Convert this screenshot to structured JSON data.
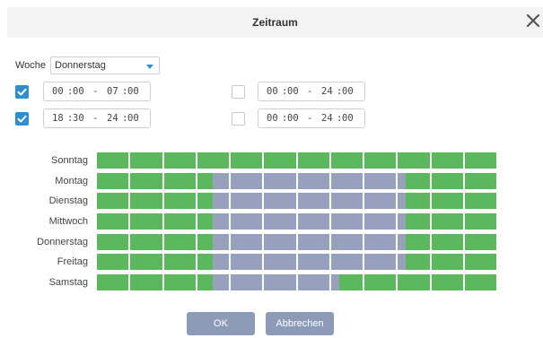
{
  "dialog": {
    "title": "Zeitraum"
  },
  "week": {
    "label": "Woche",
    "selected": "Donnerstag"
  },
  "ranges": [
    {
      "checked": true,
      "start_h": "00",
      "start_m": "00",
      "end_h": "07",
      "end_m": "00"
    },
    {
      "checked": false,
      "start_h": "00",
      "start_m": "00",
      "end_h": "24",
      "end_m": "00"
    },
    {
      "checked": true,
      "start_h": "18",
      "start_m": "30",
      "end_h": "24",
      "end_m": "00"
    },
    {
      "checked": false,
      "start_h": "00",
      "start_m": "00",
      "end_h": "24",
      "end_m": "00"
    }
  ],
  "time_sep": ":",
  "range_sep": "-",
  "schedule": {
    "segments_per_day": 12,
    "hours_per_segment": 2,
    "colors": {
      "active": "#5cb85c",
      "inactive": "#97a0bd"
    },
    "days": [
      {
        "label": "Sonntag",
        "inactive_from_hour": null,
        "inactive_to_hour": null
      },
      {
        "label": "Montag",
        "inactive_from_hour": 7,
        "inactive_to_hour": 18.5
      },
      {
        "label": "Dienstag",
        "inactive_from_hour": 7,
        "inactive_to_hour": 18.5
      },
      {
        "label": "Mittwoch",
        "inactive_from_hour": 7,
        "inactive_to_hour": 18.5
      },
      {
        "label": "Donnerstag",
        "inactive_from_hour": 7,
        "inactive_to_hour": 18.5
      },
      {
        "label": "Freitag",
        "inactive_from_hour": 7,
        "inactive_to_hour": 18.5
      },
      {
        "label": "Samstag",
        "inactive_from_hour": 7,
        "inactive_to_hour": 14.5
      }
    ]
  },
  "buttons": {
    "ok": "OK",
    "cancel": "Abbrechen"
  }
}
